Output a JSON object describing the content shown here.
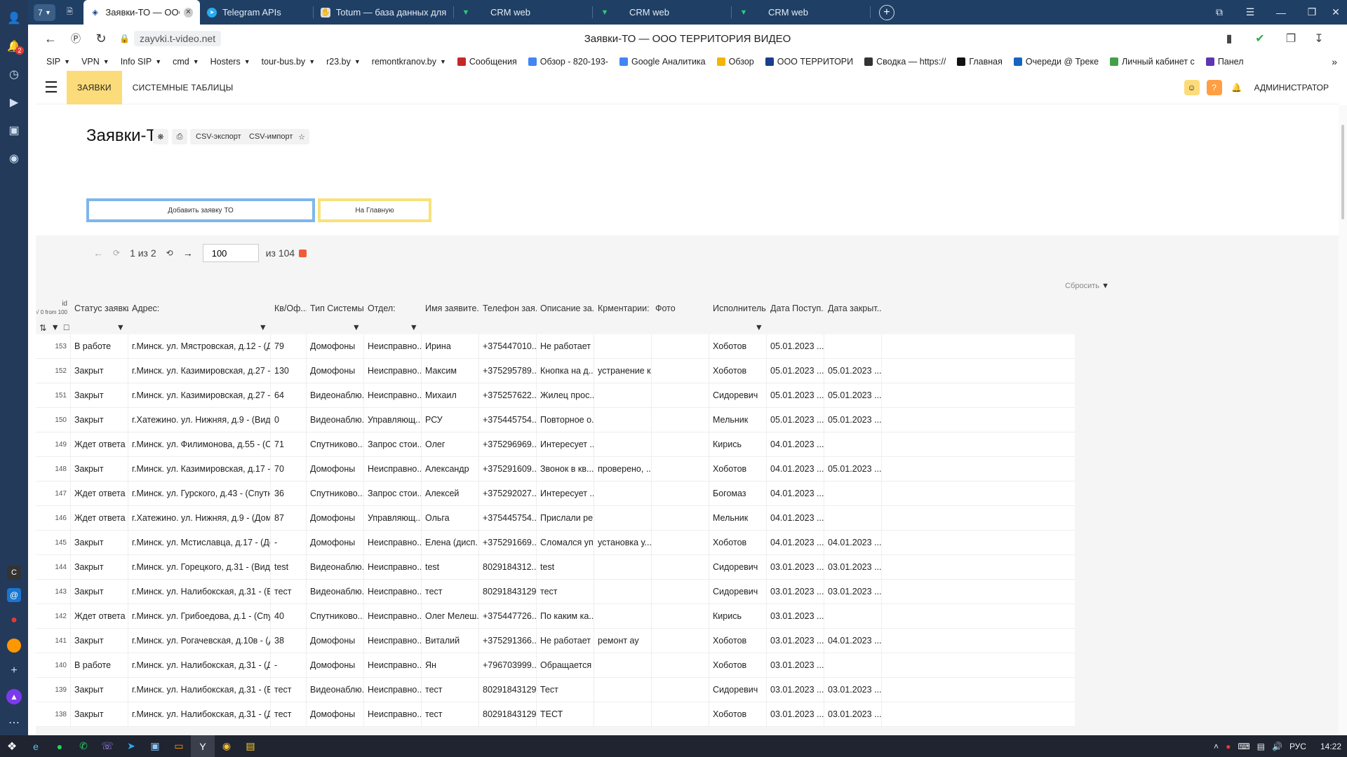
{
  "browser": {
    "tab_count": "7",
    "tabs": [
      {
        "title": "Заявки-ТО — ООО ТЕРРИТОРИЯ ВИДЕО",
        "icon": "site-icon"
      },
      {
        "title": "Telegram APIs",
        "icon": "telegram-icon"
      },
      {
        "title": "Totum — база данных для",
        "icon": "totum-icon"
      },
      {
        "title": "CRM web",
        "icon": "crm-icon"
      },
      {
        "title": "CRM web",
        "icon": "crm-icon"
      },
      {
        "title": "CRM web",
        "icon": "crm-icon"
      }
    ],
    "url": "zayvki.t-video.net",
    "page_title": "Заявки-ТО — ООО ТЕРРИТОРИЯ ВИДЕО",
    "notification_badge": "2",
    "bookmarks": [
      {
        "label": "SIP",
        "dropdown": true
      },
      {
        "label": "VPN",
        "dropdown": true
      },
      {
        "label": "Info SIP",
        "dropdown": true
      },
      {
        "label": "cmd",
        "dropdown": true
      },
      {
        "label": "Hosters",
        "dropdown": true
      },
      {
        "label": "tour-bus.by",
        "dropdown": true
      },
      {
        "label": "r23.by",
        "dropdown": true
      },
      {
        "label": "remontkranov.by",
        "dropdown": true
      },
      {
        "label": "Сообщения",
        "color": "#c62828"
      },
      {
        "label": "Обзор - 820-193-",
        "color": "#4285f4"
      },
      {
        "label": "Google Аналитика",
        "color": "#4285f4"
      },
      {
        "label": "Обзор",
        "color": "#f4b400"
      },
      {
        "label": "ООО ТЕРРИТОРИ",
        "color": "#1a3d8f"
      },
      {
        "label": "Сводка — https://",
        "color": "#333333"
      },
      {
        "label": "Главная",
        "color": "#111111"
      },
      {
        "label": "Очереди @ Треке",
        "color": "#1565c0"
      },
      {
        "label": "Личный кабинет с",
        "color": "#43a047"
      },
      {
        "label": "Панел",
        "color": "#5e35b1"
      }
    ]
  },
  "app": {
    "nav_tabs": [
      "ЗАЯВКИ",
      "СИСТЕМНЫЕ ТАБЛИЦЫ"
    ],
    "user_label": "АДМИНИСТРАТОР",
    "title": "Заявки-ТО",
    "header_buttons": {
      "csv_export": "CSV-экспорт",
      "csv_import": "CSV-импорт"
    },
    "add_button": "Добавить заявку ТО",
    "home_button": "На Главную",
    "pager": {
      "page_text": "1 из 2",
      "page_size": "100",
      "total_text": "из 104"
    },
    "reset_label": "Сбросить",
    "id_header": "id",
    "id_subheader": "√ 0 from 100",
    "accent": "#fcdc7a",
    "add_button_border": "#7fb6ea",
    "home_button_border": "#f7e27a"
  },
  "table": {
    "columns": [
      "Статус заявки:",
      "Адрес:",
      "Кв/Оф...",
      "Тип Системы",
      "Отдел:",
      "Имя заявите...",
      "Телефон зая...",
      "Описание за...",
      "Крментарии:",
      "Фото",
      "Исполнитель:",
      "Дата Поступ...",
      "Дата закрыт..."
    ],
    "filter_columns": [
      0,
      1,
      3,
      4,
      10
    ],
    "rows": [
      [
        "153",
        "В работе",
        "г.Минск. ул. Мястровская, д.12 - (До...",
        "79",
        "Домофоны",
        "Неисправно...",
        "Ирина",
        "+375447010...",
        "Не работает ...",
        "",
        "",
        "Хоботов",
        "05.01.2023 ...",
        ""
      ],
      [
        "152",
        "Закрыт",
        "г.Минск. ул. Казимировская, д.27 - (...",
        "130",
        "Домофоны",
        "Неисправно...",
        "Максим",
        "+375295789...",
        "Кнопка на д...",
        "устранение кз",
        "",
        "Хоботов",
        "05.01.2023 ...",
        "05.01.2023 ..."
      ],
      [
        "151",
        "Закрыт",
        "г.Минск. ул. Казимировская, д.27 - (В...",
        "64",
        "Видеонаблю...",
        "Неисправно...",
        "Михаил",
        "+375257622...",
        "Жилец прос...",
        "",
        "",
        "Сидоревич",
        "05.01.2023 ...",
        "05.01.2023 ..."
      ],
      [
        "150",
        "Закрыт",
        "г.Хатежино. ул. Нижняя, д.9 - (Видео...",
        "0",
        "Видеонаблю...",
        "Управляющ...",
        "РСУ",
        "+375445754...",
        "Повторное о...",
        "",
        "",
        "Мельник",
        "05.01.2023 ...",
        "05.01.2023 ..."
      ],
      [
        "149",
        "Ждет ответа",
        "г.Минск. ул. Филимонова, д.55 - (Спу...",
        "71",
        "Спутниково...",
        "Запрос стои...",
        "Олег",
        "+375296969...",
        "Интересует ...",
        "",
        "",
        "Кирись",
        "04.01.2023 ...",
        ""
      ],
      [
        "148",
        "Закрыт",
        "г.Минск. ул. Казимировская, д.17 - (...",
        "70",
        "Домофоны",
        "Неисправно...",
        "Александр",
        "+375291609...",
        "Звонок в кв...",
        "проверено, ...",
        "",
        "Хоботов",
        "04.01.2023 ...",
        "05.01.2023 ..."
      ],
      [
        "147",
        "Ждет ответа",
        "г.Минск. ул. Гурского, д.43 - (Спутник...",
        "36",
        "Спутниково...",
        "Запрос стои...",
        "Алексей",
        "+375292027...",
        "Интересует ...",
        "",
        "",
        "Богомаз",
        "04.01.2023 ...",
        ""
      ],
      [
        "146",
        "Ждет ответа",
        "г.Хатежино. ул. Нижняя, д.9 - (Домоф...",
        "87",
        "Домофоны",
        "Управляющ...",
        "Ольга",
        "+375445754...",
        "Прислали ре...",
        "",
        "",
        "Мельник",
        "04.01.2023 ...",
        ""
      ],
      [
        "145",
        "Закрыт",
        "г.Минск. ул. Мстиславца, д.17 - (Дом...",
        "-",
        "Домофоны",
        "Неисправно...",
        "Елена (дисп...",
        "+375291669...",
        "Сломался уп...",
        "установка у...",
        "",
        "Хоботов",
        "04.01.2023 ...",
        "04.01.2023 ..."
      ],
      [
        "144",
        "Закрыт",
        "г.Минск. ул. Горецкого, д.31 - (Видео...",
        "test",
        "Видеонаблю...",
        "Неисправно...",
        "test",
        "8029184312...",
        "test",
        "",
        "",
        "Сидоревич",
        "03.01.2023 ...",
        "03.01.2023 ..."
      ],
      [
        "143",
        "Закрыт",
        "г.Минск. ул. Налибокская, д.31 - (Вид...",
        "тест",
        "Видеонаблю...",
        "Неисправно...",
        "тест",
        "80291843129",
        "тест",
        "",
        "",
        "Сидоревич",
        "03.01.2023 ...",
        "03.01.2023 ..."
      ],
      [
        "142",
        "Ждет ответа",
        "г.Минск. ул. Грибоедова, д.1 - (Спутн...",
        "40",
        "Спутниково...",
        "Неисправно...",
        "Олег Мелеш...",
        "+375447726...",
        "По каким ка...",
        "",
        "",
        "Кирись",
        "03.01.2023 ...",
        ""
      ],
      [
        "141",
        "Закрыт",
        "г.Минск. ул. Рогачевская, д.10в - (До...",
        "38",
        "Домофоны",
        "Неисправно...",
        "Виталий",
        "+375291366...",
        "Не работает ...",
        "ремонт ау",
        "",
        "Хоботов",
        "03.01.2023 ...",
        "04.01.2023 ..."
      ],
      [
        "140",
        "В работе",
        "г.Минск. ул. Налибокская, д.31 - (До...",
        "-",
        "Домофоны",
        "Неисправно...",
        "Ян",
        "+796703999...",
        "Обращается ...",
        "",
        "",
        "Хоботов",
        "03.01.2023 ...",
        ""
      ],
      [
        "139",
        "Закрыт",
        "г.Минск. ул. Налибокская, д.31 - (Вид...",
        "тест",
        "Видеонаблю...",
        "Неисправно...",
        "тест",
        "80291843129",
        "Тест",
        "",
        "",
        "Сидоревич",
        "03.01.2023 ...",
        "03.01.2023 ..."
      ],
      [
        "138",
        "Закрыт",
        "г.Минск. ул. Налибокская, д.31 - (До...",
        "тест",
        "Домофоны",
        "Неисправно...",
        "тест",
        "80291843129",
        "ТЕСТ",
        "",
        "",
        "Хоботов",
        "03.01.2023 ...",
        "03.01.2023 ..."
      ]
    ]
  },
  "taskbar": {
    "lang": "РУС",
    "time": "14:22"
  }
}
